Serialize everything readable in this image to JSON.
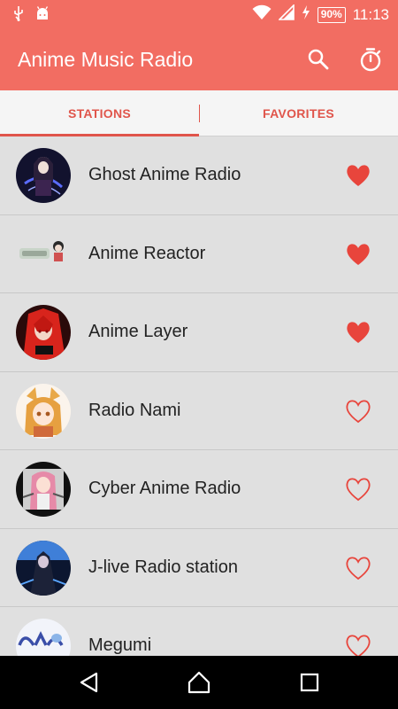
{
  "status_bar": {
    "battery": "90%",
    "time": "11:13"
  },
  "app_bar": {
    "title": "Anime Music Radio"
  },
  "tabs": [
    {
      "label": "STATIONS",
      "selected": true
    },
    {
      "label": "FAVORITES",
      "selected": false
    }
  ],
  "stations": [
    {
      "name": "Ghost Anime Radio",
      "favorite": true
    },
    {
      "name": "Anime Reactor",
      "favorite": true
    },
    {
      "name": "Anime Layer",
      "favorite": true
    },
    {
      "name": "Radio Nami",
      "favorite": false
    },
    {
      "name": "Cyber Anime Radio",
      "favorite": false
    },
    {
      "name": "J-live Radio station",
      "favorite": false
    },
    {
      "name": "Megumi",
      "favorite": false
    }
  ],
  "colors": {
    "accent": "#f26d62",
    "heart": "#e8453c"
  }
}
